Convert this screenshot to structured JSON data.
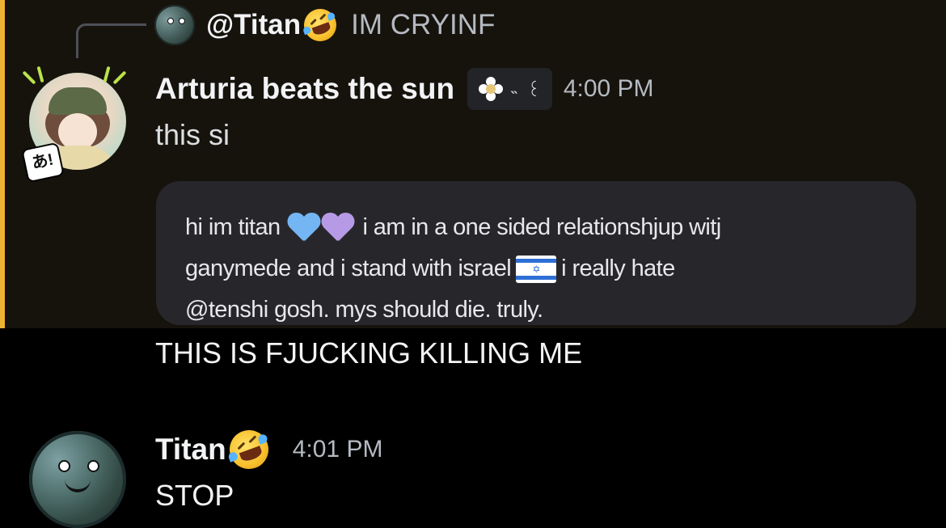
{
  "reply": {
    "author": "@Titan",
    "author_emoji": "rolling-on-floor-laughing-emoji",
    "content": "IM CRYINF"
  },
  "message1": {
    "author": "Arturia beats the sun",
    "tag_icon": "white-flower-icon",
    "tag_text": "˵ ⁠ ꒰",
    "timestamp": "4:00 PM",
    "deco_badge": "あ!",
    "text": "this si",
    "image_text": {
      "line1_a": "hi im titan",
      "line1_b": "i am in a one sided relationshjup witj",
      "line2_a": "ganymede and i stand with israel",
      "line2_b": "i really hate",
      "line3": "@tenshi gosh. mys should die. truly."
    },
    "followup": "THIS IS FJUCKING KILLING ME"
  },
  "message2": {
    "author": "Titan",
    "author_emoji": "rolling-on-floor-laughing-emoji",
    "timestamp": "4:01 PM",
    "text": "STOP"
  },
  "colors": {
    "background": "#000000",
    "mention_highlight": "#16130d",
    "mention_bar": "#f0b232",
    "muted_text": "#b5bac1"
  }
}
